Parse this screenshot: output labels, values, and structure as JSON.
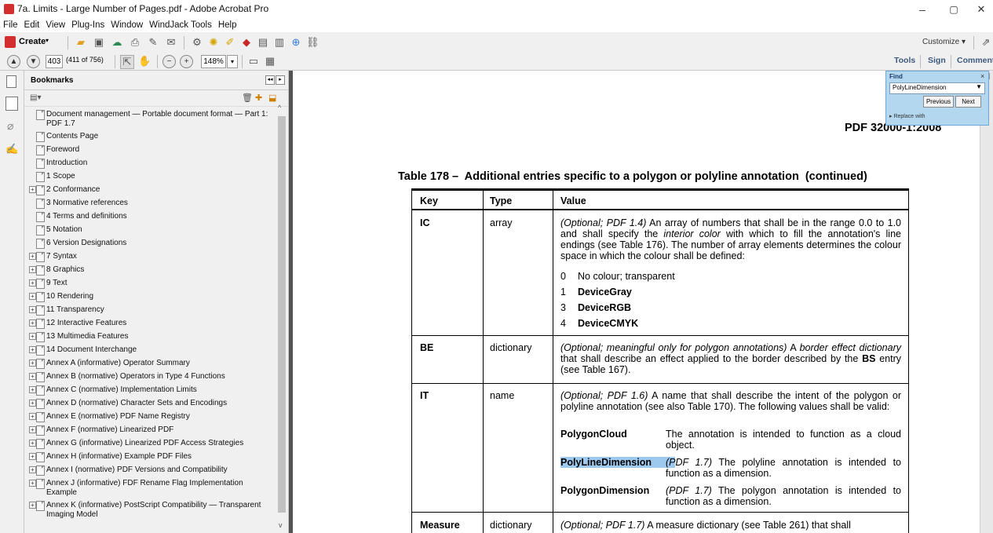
{
  "window": {
    "title": "7a. Limits - Large Number of Pages.pdf - Adobe Acrobat Pro",
    "controls": [
      "–",
      "▢",
      "✕"
    ]
  },
  "menu": [
    "File",
    "Edit",
    "View",
    "Plug-Ins",
    "Window",
    "WindJack Tools",
    "Help"
  ],
  "toolbar": {
    "create_label": "Create",
    "customize_label": "Customize",
    "page_number": "403",
    "page_count": "(411 of 756)",
    "zoom": "148%",
    "tools_label": "Tools",
    "sign_label": "Sign",
    "comment_label": "Comment"
  },
  "bookmarks": {
    "title": "Bookmarks",
    "items": [
      {
        "label": "Document management — Portable document format — Part 1: PDF 1.7",
        "expandable": false
      },
      {
        "label": "Contents Page",
        "expandable": false
      },
      {
        "label": "Foreword",
        "expandable": false
      },
      {
        "label": "Introduction",
        "expandable": false
      },
      {
        "label": "1 Scope",
        "expandable": false
      },
      {
        "label": "2 Conformance",
        "expandable": true
      },
      {
        "label": "3 Normative references",
        "expandable": false
      },
      {
        "label": "4 Terms and definitions",
        "expandable": false
      },
      {
        "label": "5 Notation",
        "expandable": false
      },
      {
        "label": "6 Version Designations",
        "expandable": false
      },
      {
        "label": "7 Syntax",
        "expandable": true
      },
      {
        "label": "8 Graphics",
        "expandable": true
      },
      {
        "label": "9 Text",
        "expandable": true
      },
      {
        "label": "10 Rendering",
        "expandable": true
      },
      {
        "label": "11 Transparency",
        "expandable": true
      },
      {
        "label": "12 Interactive Features",
        "expandable": true
      },
      {
        "label": "13 Multimedia Features",
        "expandable": true
      },
      {
        "label": "14 Document Interchange",
        "expandable": true
      },
      {
        "label": "Annex A (informative) Operator Summary",
        "expandable": true
      },
      {
        "label": "Annex B (normative) Operators in Type 4 Functions",
        "expandable": true
      },
      {
        "label": "Annex C (normative) Implementation Limits",
        "expandable": true
      },
      {
        "label": "Annex D (normative) Character Sets and Encodings",
        "expandable": true
      },
      {
        "label": "Annex E (normative) PDF Name Registry",
        "expandable": true
      },
      {
        "label": "Annex F (normative) Linearized PDF",
        "expandable": true
      },
      {
        "label": "Annex G (informative) Linearized PDF Access Strategies",
        "expandable": true
      },
      {
        "label": "Annex H (informative) Example PDF Files",
        "expandable": true
      },
      {
        "label": "Annex I (normative) PDF Versions and Compatibility",
        "expandable": true
      },
      {
        "label": "Annex J (informative) FDF Rename Flag Implementation Example",
        "expandable": true
      },
      {
        "label": "Annex K (informative) PostScript Compatibility — Transparent Imaging Model",
        "expandable": true
      }
    ]
  },
  "find": {
    "title": "Find",
    "query": "PolyLineDimension",
    "previous_label": "Previous",
    "next_label": "Next",
    "replace_label": "Replace with",
    "close": "×"
  },
  "document": {
    "running_header": "PDF 32000-1:2008",
    "table_caption": "Table 178 –  Additional entries specific to a polygon or polyline annotation  (continued)",
    "headers": [
      "Key",
      "Type",
      "Value"
    ],
    "rows": {
      "ic": {
        "key": "IC",
        "type": "array",
        "value_pre": "(Optional; PDF 1.4)",
        "value_mid1": " An array of numbers that shall be in the range 0.0 to 1.0 and shall specify the ",
        "value_italic": "interior color",
        "value_mid2": " with which to fill the annotation's line endings (see Table 176). The number of array elements determines the colour space in which the colour shall be defined:",
        "list": [
          {
            "n": "0",
            "t": "No colour; transparent",
            "bold": false
          },
          {
            "n": "1",
            "t": "DeviceGray",
            "bold": true
          },
          {
            "n": "3",
            "t": "DeviceRGB",
            "bold": true
          },
          {
            "n": "4",
            "t": "DeviceCMYK",
            "bold": true
          }
        ]
      },
      "be": {
        "key": "BE",
        "type": "dictionary",
        "value_italic": "(Optional; meaningful only for polygon annotations)",
        "value_mid1": " A ",
        "value_italic2": "border effect dictionary",
        "value_mid2": " that shall describe an effect applied to the border described by the ",
        "value_bold": "BS",
        "value_end": " entry (see Table 167)."
      },
      "it": {
        "key": "IT",
        "type": "name",
        "value_italic": "(Optional; PDF 1.6)",
        "value_rest": " A name that shall describe the intent of the polygon or polyline annotation (see also Table 170). The following values shall be valid:",
        "names": [
          {
            "name": "PolygonCloud",
            "prefix": "",
            "desc": "The annotation is intended to function as a cloud object.",
            "highlight": false
          },
          {
            "name": "PolyLineDimension",
            "prefix": "(PDF 1.7)",
            "desc": " The polyline annotation is intended to function as a dimension.",
            "highlight": true
          },
          {
            "name": "PolygonDimension",
            "prefix": "(PDF 1.7)",
            "desc": " The polygon annotation is intended to function as a dimension.",
            "highlight": false
          }
        ]
      },
      "measure": {
        "key": "Measure",
        "type": "dictionary",
        "value_italic": "(Optional; PDF 1.7)",
        "value_rest": " A measure dictionary (see Table 261) that shall"
      }
    }
  },
  "colors": {
    "chrome_bg": "#f0f0f0",
    "doc_bg": "#535353",
    "find_bg": "#b4d7f0",
    "highlight": "#9ec9ee"
  }
}
